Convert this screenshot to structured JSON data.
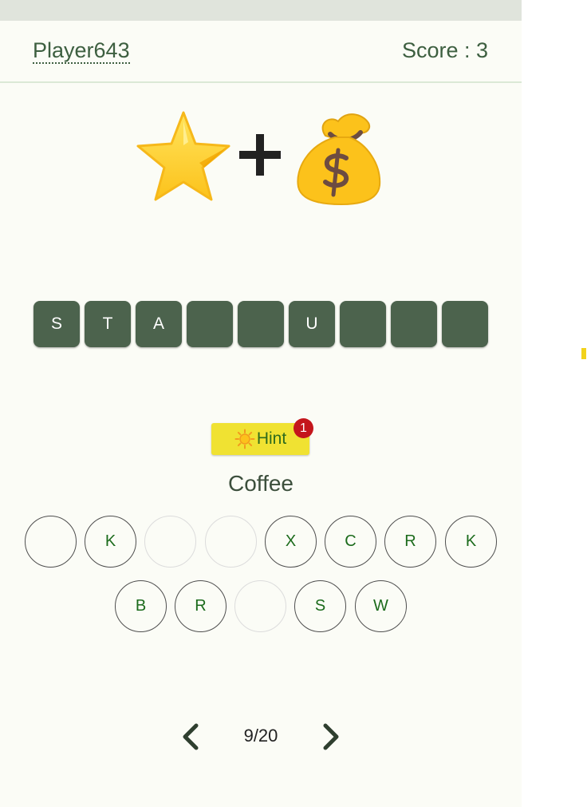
{
  "header": {
    "player": "Player643",
    "score": "Score : 3"
  },
  "puzzle": {
    "emojis": [
      "star-emoji",
      "plus-sign",
      "money-bag-emoji"
    ],
    "answer_slots": [
      "S",
      "T",
      "A",
      "",
      "",
      "U",
      "",
      "",
      ""
    ]
  },
  "hint": {
    "label": "Hint",
    "icon": "sun-icon",
    "badge_count": "1"
  },
  "category": "Coffee",
  "letters": {
    "row1": [
      "",
      "K",
      "",
      "",
      "X",
      "C",
      "R",
      "K"
    ],
    "row2": [
      "B",
      "R",
      "",
      "S",
      "W"
    ]
  },
  "pagination": {
    "text": "9/20",
    "current": 9,
    "total": 20
  },
  "colors": {
    "background": "#fbfcf6",
    "slot": "#4c634d",
    "hint_button": "#f0e232",
    "badge": "#c4161c",
    "letter_text": "#1c6b1c"
  }
}
